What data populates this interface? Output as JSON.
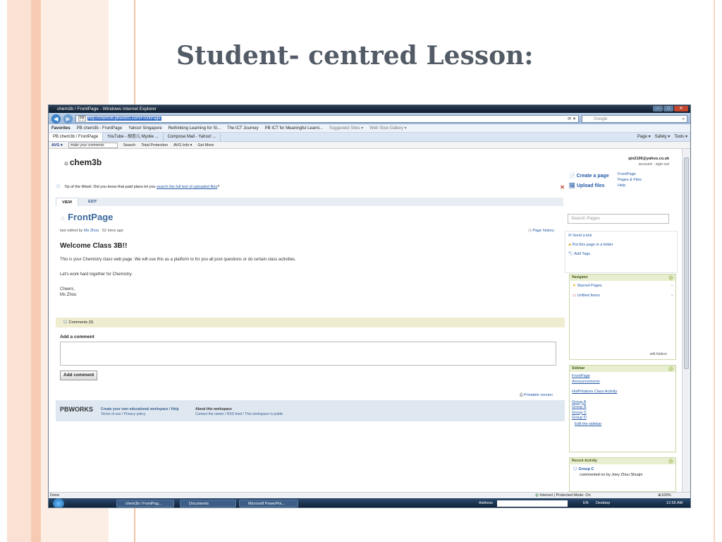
{
  "slide": {
    "title": "Student- centred Lesson:"
  },
  "browser": {
    "window_title": "chem3b / FrontPage - Windows Internet Explorer",
    "url": "http://chem3b.pbworks.com/FrontPage",
    "search_placeholder": "Google",
    "favorites": [
      "Favorites",
      "PB chem3b - FrontPage",
      "Yahoo! Singapore",
      "Rethinking Learning for St...",
      "The ICT Journey",
      "PB ICT for Meaningful Learni...",
      "Suggested Sites ▾",
      "Web Slice Gallery ▾"
    ],
    "tabs": [
      "PB chem3b / FrontPage",
      "YouTube - 胡杏儿 Myolie ...",
      "Compose Mail - Yahoo! ..."
    ],
    "commands": [
      "Page ▾",
      "Safety ▾",
      "Tools ▾"
    ],
    "avg": {
      "logo": "AVG ▾",
      "input": "make your comments",
      "search": "Search",
      "protection": "Total Protection",
      "info": "AVG Info ▾",
      "more": "Get More"
    }
  },
  "page": {
    "workspace": "chem3b",
    "account_email": "qin2106@yahoo.co.uk",
    "account_links": "account · sign out",
    "tip_label": "Tip of the Week:",
    "tip_text": " Did you know that paid plans let you ",
    "tip_link": "search the full text of uploaded files",
    "tip_end": "?",
    "view_tab": "VIEW",
    "edit_tab": "EDIT",
    "title": "FrontPage",
    "meta_prefix": "last edited by",
    "meta_author": "Ms Zhou",
    "meta_time": "52 mins ago",
    "page_history": "Page history",
    "heading": "Welcome Class 3B!!",
    "para1": "This is your Chemistry class web page. We will use this as a platform to for you all post questions or do certain class activities.",
    "para2": "Let's work hard together for Chemistry.",
    "sign1": "Cheers,",
    "sign2": "Ms Zhou",
    "comments": "Comments (0)",
    "add_comment_label": "Add a comment",
    "add_comment_button": "Add comment",
    "printable": "Printable version",
    "footer_logo": "PBWORKS",
    "footer_col1_a": "Create your own educational workspace / Help",
    "footer_col1_b": "Terms of use / Privacy policy",
    "footer_col2_a": "About this workspace",
    "footer_col2_b": "Contact the owner / RSS feed / This workspace is public"
  },
  "sidebar": {
    "create_page": "Create a page",
    "upload_files": "Upload files",
    "links": [
      "FrontPage",
      "Pages & Files",
      "Help"
    ],
    "search_placeholder": "Search Pages",
    "actions": [
      "Send a link",
      "Put this page in a folder",
      "Add Tags"
    ],
    "navigator_title": "Navigator",
    "navigator_items": [
      "Starred Pages",
      "Unfiled Items"
    ],
    "edit_folders": "edit folders",
    "sidebar_title": "Sidebar",
    "sidebar_links": [
      "FrontPage",
      "Announcements",
      "HotPotatoes Class Activity",
      "Group A",
      "Group B",
      "Group C",
      "Group D",
      "Edit the sidebar"
    ],
    "recent_title": "Recent Activity",
    "recent_item": "Group C",
    "recent_text": "commented on by Joey Zhou Shuqin"
  },
  "status": {
    "left": "Done",
    "zone": "Internet | Protected Mode: On",
    "zoom": "100%"
  },
  "taskbar": {
    "items": [
      "chem3b / FrontPag...",
      "Documents",
      "Microsoft PowerPoi..."
    ],
    "address": "Address",
    "lang": "EN",
    "desktop": "Desktop",
    "time": "12:55 AM"
  }
}
